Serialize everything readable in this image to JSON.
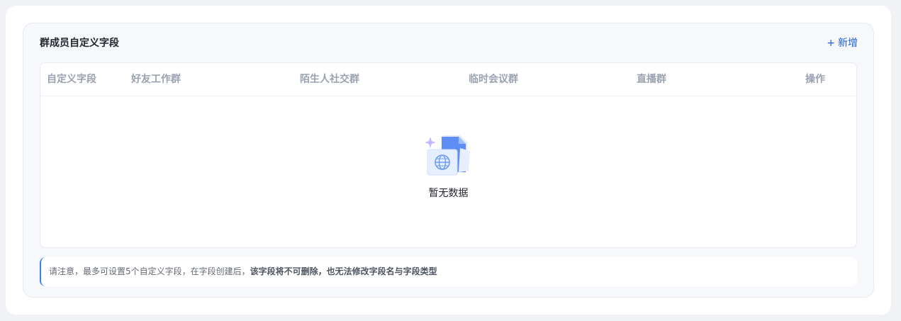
{
  "panel": {
    "title": "群成员自定义字段",
    "add_plus": "+",
    "add_label": "新增"
  },
  "table": {
    "columns": [
      "自定义字段",
      "好友工作群",
      "陌生人社交群",
      "临时会议群",
      "直播群",
      "操作"
    ],
    "rows": [],
    "empty_text": "暂无数据",
    "empty_icon": "empty-document-icon"
  },
  "notice": {
    "prefix": "请注意，最多可设置5个自定义字段，在字段创建后，",
    "emphasis": "该字段将不可删除，也无法修改字段名与字段类型"
  },
  "colors": {
    "accent": "#1f5fd6",
    "panel_bg": "#f7f8fc",
    "header_text": "#9aa1b0",
    "notice_border": "#3d7cf0"
  }
}
